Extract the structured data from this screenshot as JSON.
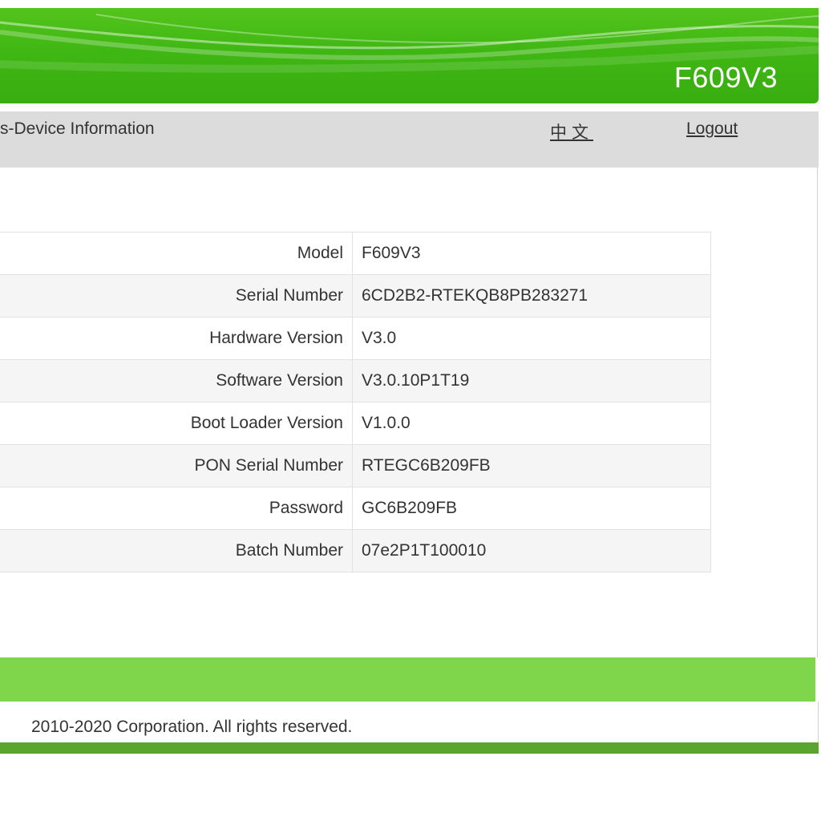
{
  "header": {
    "model": "F609V3"
  },
  "nav": {
    "title": "s-Device Information",
    "language_link": "中文",
    "logout_label": "Logout"
  },
  "device_info": {
    "rows": [
      {
        "label": "Model",
        "value": "F609V3"
      },
      {
        "label": "Serial Number",
        "value": "6CD2B2-RTEKQB8PB283271"
      },
      {
        "label": "Hardware Version",
        "value": "V3.0"
      },
      {
        "label": "Software Version",
        "value": "V3.0.10P1T19"
      },
      {
        "label": "Boot Loader Version",
        "value": "V1.0.0"
      },
      {
        "label": "PON Serial Number",
        "value": "RTEGC6B209FB"
      },
      {
        "label": "Password",
        "value": "GC6B209FB"
      },
      {
        "label": "Batch Number",
        "value": "07e2P1T100010"
      }
    ]
  },
  "footer": {
    "copyright": "2010-2020 Corporation. All rights reserved."
  },
  "colors": {
    "banner_green": "#3fb713",
    "footer_green": "#7fd64a",
    "footer_line_green": "#5aa52e",
    "nav_gray": "#dcdcdc"
  }
}
